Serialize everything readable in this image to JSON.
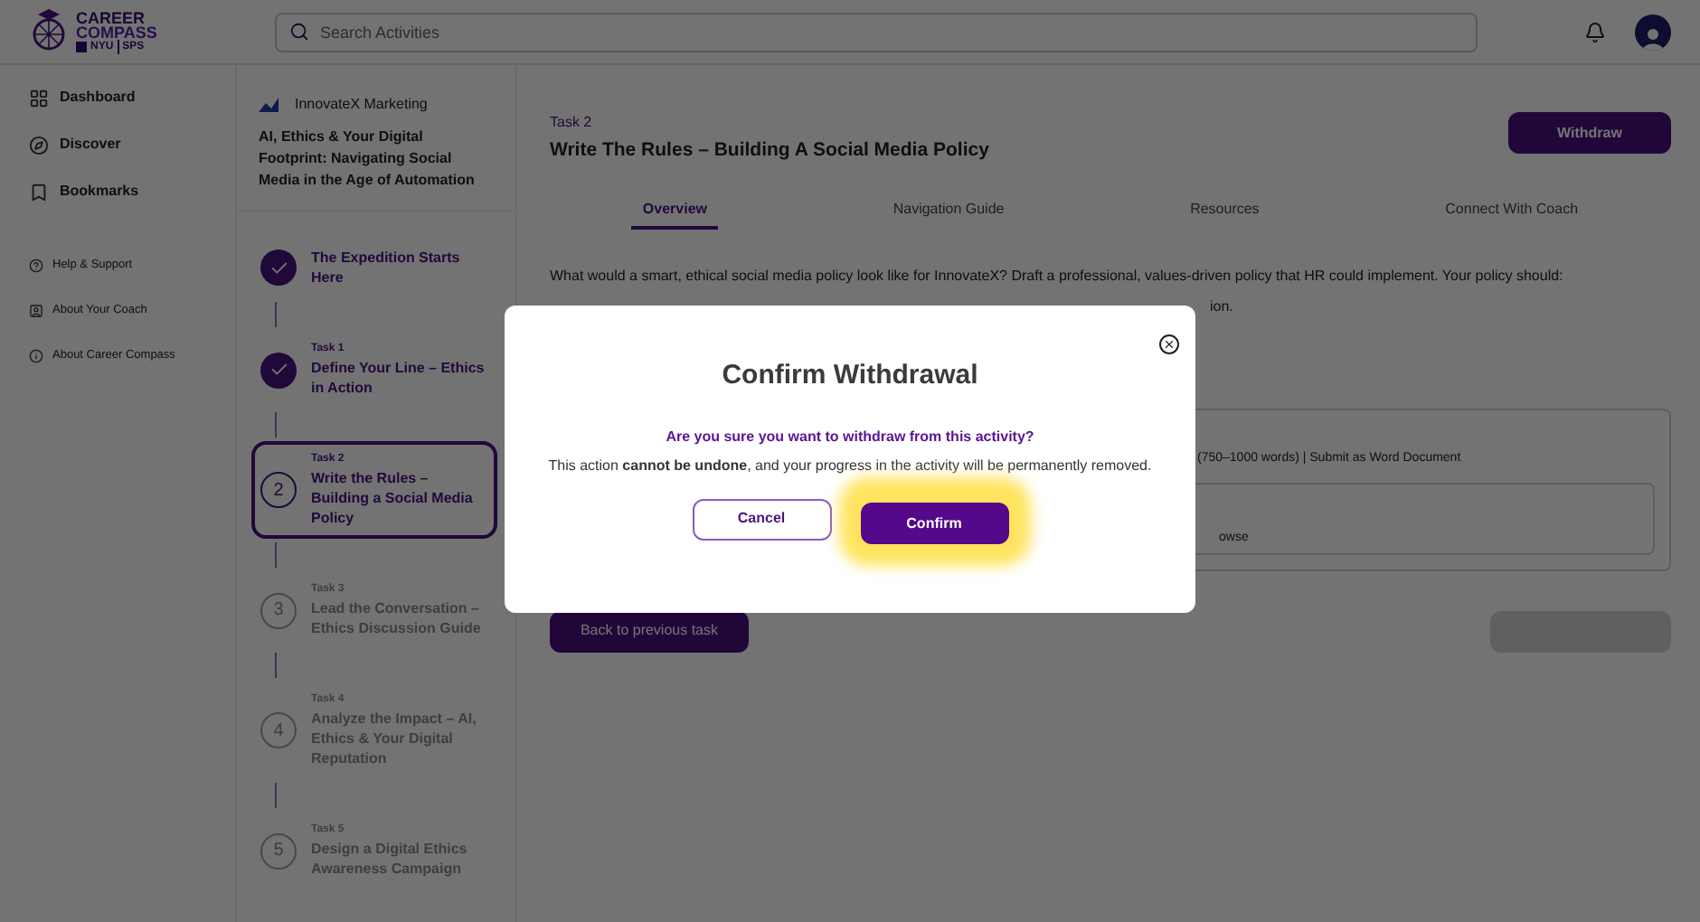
{
  "logo": {
    "line1": "CAREER",
    "line2": "COMPASS",
    "school": "NYU",
    "unit": "SPS"
  },
  "search": {
    "placeholder": "Search Activities"
  },
  "nav": [
    {
      "label": "Dashboard",
      "kind": "dashboard"
    },
    {
      "label": "Discover",
      "kind": "discover"
    },
    {
      "label": "Bookmarks",
      "kind": "bookmark"
    }
  ],
  "links": [
    {
      "label": "Help & Support",
      "kind": "help"
    },
    {
      "label": "About Your Coach",
      "kind": "coach"
    },
    {
      "label": "About Career Compass",
      "kind": "info"
    }
  ],
  "activity": {
    "company": "InnovateX Marketing",
    "title": "AI, Ethics & Your Digital Footprint: Navigating Social Media in the Age of Automation"
  },
  "steps": [
    {
      "kind": "done",
      "title": "The Expedition Starts Here"
    },
    {
      "kind": "done",
      "label": "Task 1",
      "title": "Define Your Line – Ethics in Action"
    },
    {
      "kind": "current",
      "label": "Task 2",
      "number": "2",
      "title": "Write the Rules – Building a Social Media Policy"
    },
    {
      "kind": "locked",
      "label": "Task 3",
      "number": "3",
      "title": "Lead the Conversation – Ethics Discussion Guide"
    },
    {
      "kind": "locked",
      "label": "Task 4",
      "number": "4",
      "title": "Analyze the Impact – AI, Ethics & Your Digital Reputation"
    },
    {
      "kind": "locked",
      "label": "Task 5",
      "number": "5",
      "title": "Design a Digital Ethics Awareness Campaign"
    }
  ],
  "task": {
    "label": "Task 2",
    "title": "Write The Rules – Building A Social Media Policy",
    "withdraw": "Withdraw"
  },
  "tabs": [
    {
      "label": "Overview",
      "selected": true
    },
    {
      "label": "Navigation Guide",
      "selected": false
    },
    {
      "label": "Resources",
      "selected": false
    },
    {
      "label": "Connect With Coach",
      "selected": false
    }
  ],
  "intro": "What would a smart, ethical social media policy look like for InnovateX? Draft a professional, values-driven policy that HR could implement. Your policy should:",
  "fragment_line": "ion.",
  "deliverable": "(750–1000 words) | Submit as Word Document",
  "upload_fragment": "owse",
  "back_button": "Back to previous task",
  "modal": {
    "title": "Confirm Withdrawal",
    "question": "Are you sure you want to withdraw from this activity?",
    "message": "This action **cannot be undone**, and your progress in the activity will be permanently removed.",
    "cancel": "Cancel",
    "confirm": "Confirm"
  }
}
